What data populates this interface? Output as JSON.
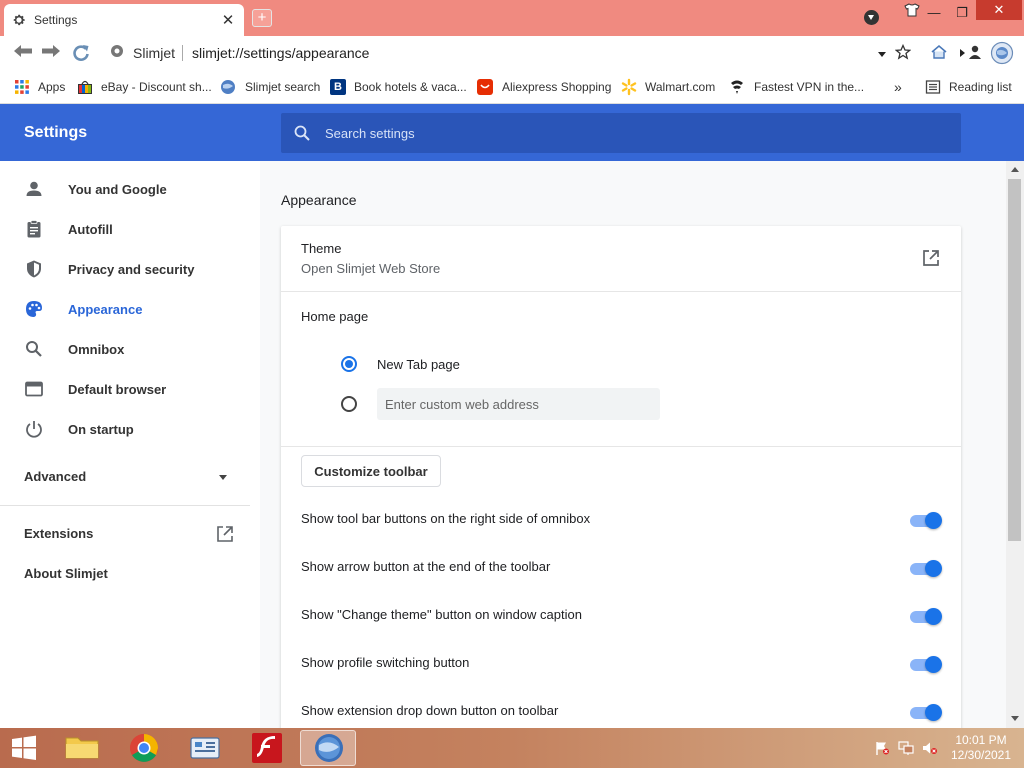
{
  "window": {
    "tab_title": "Settings",
    "tab_close": "✕",
    "new_tab": "+",
    "minimize": "—",
    "restore": "❐",
    "close": "✕"
  },
  "toolbar": {
    "site_name": "Slimjet",
    "url": "slimjet://settings/appearance"
  },
  "bookmarks": [
    {
      "label": "Apps"
    },
    {
      "label": "eBay - Discount sh..."
    },
    {
      "label": "Slimjet search"
    },
    {
      "label": "Book hotels & vaca..."
    },
    {
      "label": "Aliexpress Shopping"
    },
    {
      "label": "Walmart.com"
    },
    {
      "label": "Fastest VPN in the..."
    },
    {
      "label": "»"
    },
    {
      "label": "Reading list"
    }
  ],
  "header": {
    "title": "Settings",
    "search_placeholder": "Search settings"
  },
  "sidebar": {
    "items": [
      {
        "label": "You and Google",
        "icon": "person-icon"
      },
      {
        "label": "Autofill",
        "icon": "clipboard-icon"
      },
      {
        "label": "Privacy and security",
        "icon": "shield-icon"
      },
      {
        "label": "Appearance",
        "icon": "palette-icon"
      },
      {
        "label": "Omnibox",
        "icon": "search-icon"
      },
      {
        "label": "Default browser",
        "icon": "browser-icon"
      },
      {
        "label": "On startup",
        "icon": "power-icon"
      }
    ],
    "advanced": "Advanced",
    "extensions": "Extensions",
    "about": "About Slimjet"
  },
  "main": {
    "section_title": "Appearance",
    "theme": {
      "label": "Theme",
      "sublabel": "Open Slimjet Web Store"
    },
    "home_page": {
      "label": "Home page",
      "option_new_tab": "New Tab page",
      "custom_placeholder": "Enter custom web address"
    },
    "customize_toolbar": "Customize toolbar",
    "toggles": [
      {
        "label": "Show tool bar buttons on the right side of omnibox",
        "on": true
      },
      {
        "label": "Show arrow button at the end of the toolbar",
        "on": true
      },
      {
        "label": "Show \"Change theme\" button on window caption",
        "on": true
      },
      {
        "label": "Show profile switching button",
        "on": true
      },
      {
        "label": "Show extension drop down button on toolbar",
        "on": true
      }
    ]
  },
  "taskbar": {
    "time": "10:01 PM",
    "date": "12/30/2021"
  },
  "colors": {
    "header_blue": "#3567d6",
    "accent": "#1a73e8",
    "tabstrip": "#f08a80"
  }
}
